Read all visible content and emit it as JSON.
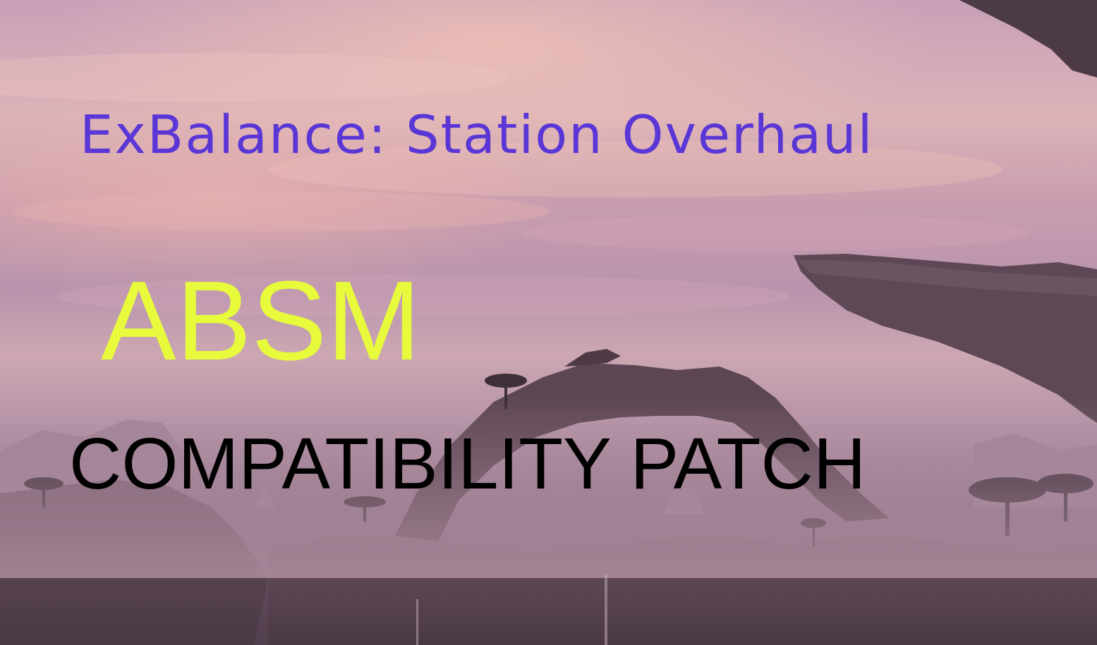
{
  "banner": {
    "title": "ExBalance: Station Overhaul",
    "subtitle": "ABSM",
    "tagline": "COMPATIBILITY PATCH"
  },
  "colors": {
    "title": "#5a36d6",
    "subtitle": "#e8fa3c",
    "tagline": "#000000",
    "sky_top": "#c8a0b8",
    "sky_glow": "#ffcdb4",
    "rock": "#5b4452",
    "mist": "#b896a8"
  }
}
